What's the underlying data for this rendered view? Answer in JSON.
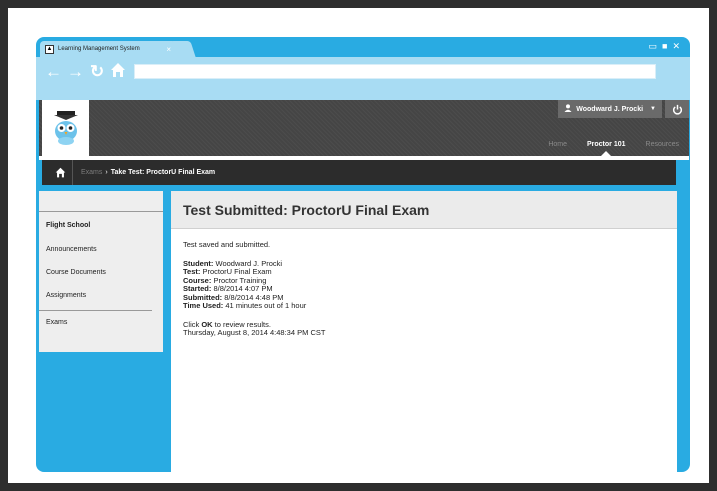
{
  "browser": {
    "tab_title": "Learning Management System",
    "tab_close": "×",
    "window_controls": [
      "▭",
      "■",
      "✕"
    ],
    "nav_icons": [
      "back-arrow-icon",
      "forward-arrow-icon",
      "reload-icon",
      "home-icon"
    ],
    "address_value": ""
  },
  "header": {
    "user_name": "Woodward J. Procki",
    "user_caret": "▼",
    "nav": [
      {
        "label": "Home",
        "active": false
      },
      {
        "label": "Proctor 101",
        "active": true
      },
      {
        "label": "Resources",
        "active": false
      }
    ]
  },
  "breadcrumb": {
    "parent": "Exams",
    "separator": "›",
    "current": "Take Test: ProctorU Final Exam"
  },
  "sidebar": {
    "heading": "Flight School",
    "items": [
      "Announcements",
      "Course Documents",
      "Assignments"
    ],
    "bottom_items": [
      "Exams"
    ]
  },
  "main": {
    "title": "Test Submitted: ProctorU Final Exam",
    "status_text": "Test saved and submitted.",
    "details": [
      {
        "label": "Student:",
        "value": "Woodward J. Procki"
      },
      {
        "label": "Test:",
        "value": "ProctorU Final Exam"
      },
      {
        "label": "Course:",
        "value": "Proctor Training"
      },
      {
        "label": "Started:",
        "value": "8/8/2014 4:07 PM"
      },
      {
        "label": "Submitted:",
        "value": "8/8/2014 4:48 PM"
      },
      {
        "label": "Time Used:",
        "value": "41 minutes out of 1 hour"
      }
    ],
    "instruction_prefix": "Click ",
    "instruction_bold": "OK",
    "instruction_suffix": " to review results.",
    "timestamp": "Thursday, August 8, 2014 4:48:34 PM CST"
  },
  "colors": {
    "frame": "#29abe2",
    "toolbar": "#a8dcf3",
    "header": "#454545",
    "crumb": "#2c2c2c"
  }
}
